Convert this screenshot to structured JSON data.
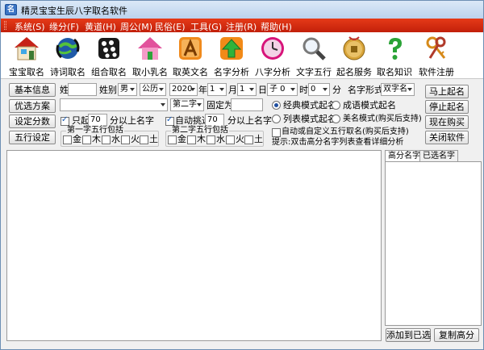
{
  "window": {
    "title": "精灵宝宝生辰八字取名软件"
  },
  "menu": [
    "系统(S)",
    "缘分(F)",
    "黄道(H)",
    "周公(M)",
    "民俗(E)",
    "工具(G)",
    "注册(R)",
    "帮助(H)"
  ],
  "toolbar": [
    {
      "label": "宝宝取名",
      "icon": "house-icon"
    },
    {
      "label": "诗词取名",
      "icon": "globe-refresh-icon"
    },
    {
      "label": "组合取名",
      "icon": "blackberry-icon"
    },
    {
      "label": "取小乳名",
      "icon": "pink-house-icon"
    },
    {
      "label": "取英文名",
      "icon": "app-store-icon"
    },
    {
      "label": "名字分析",
      "icon": "arrow-up-icon"
    },
    {
      "label": "八字分析",
      "icon": "clock-icon"
    },
    {
      "label": "文字五行",
      "icon": "magnifier-icon"
    },
    {
      "label": "起名服务",
      "icon": "coin-icon"
    },
    {
      "label": "取名知识",
      "icon": "question-icon"
    },
    {
      "label": "软件注册",
      "icon": "keys-icon"
    }
  ],
  "left_buttons": [
    "基本信息",
    "优选方案",
    "设定分数",
    "五行设定"
  ],
  "right_buttons": [
    "马上起名",
    "停止起名",
    "现在购买",
    "关闭软件"
  ],
  "form": {
    "surname_label": "姓",
    "gender_label": "姓别",
    "gender_value": "男",
    "calendar_value": "公历",
    "year_value": "2020",
    "year_label": "年",
    "month_value": "1",
    "month_label": "月",
    "day_value": "1",
    "day_label": "日",
    "hour_value": "子 0",
    "hour_label": "时",
    "minute_value": "0",
    "minute_label": "分",
    "name_format_label": "名字形式",
    "name_format_value": "双字名",
    "second_char_value": "第二字",
    "fixed_label": "固定为",
    "only_label": "只起",
    "only_score": "70",
    "only_suffix": "分以上名字",
    "auto_label": "自动挑选",
    "auto_score": "70",
    "auto_suffix": "分以上名字",
    "group1_title": "第一字五行包括",
    "group2_title": "第二字五行包括",
    "elements": [
      "金",
      "木",
      "水",
      "火",
      "土"
    ],
    "mode_classic": "经典模式起名",
    "mode_idiom": "成语模式起名",
    "mode_list": "列表模式起名",
    "mode_beauty": "美名模式(购买后支持)",
    "custom_wuxing": "自动或自定义五行取名(购买后支持)",
    "hint": "提示:双击高分名字列表查看详细分析"
  },
  "tabs": [
    "高分名字",
    "已选名字"
  ],
  "bottom_buttons": [
    "添加到已选",
    "复制高分"
  ]
}
